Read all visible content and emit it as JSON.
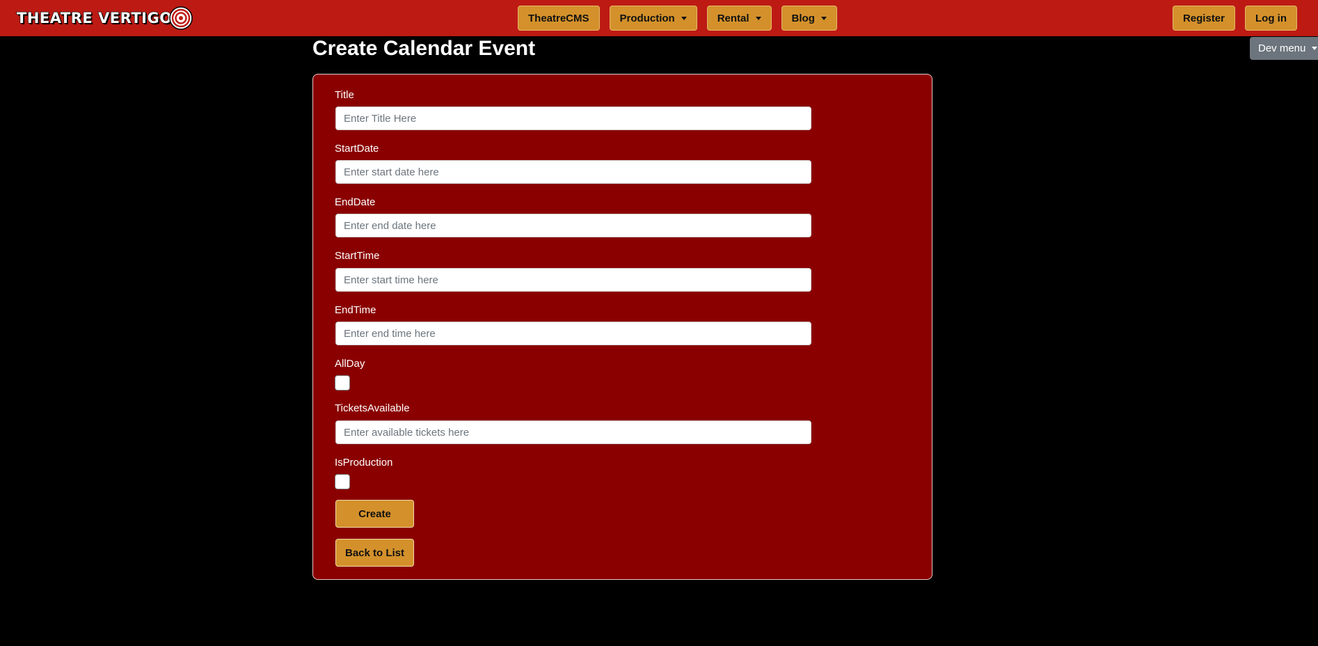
{
  "brand": {
    "name": "THEATRE VERTIGO",
    "logo_icon": "spiral-logo-icon"
  },
  "nav": {
    "center": [
      {
        "label": "TheatreCMS",
        "dropdown": false
      },
      {
        "label": "Production",
        "dropdown": true
      },
      {
        "label": "Rental",
        "dropdown": true
      },
      {
        "label": "Blog",
        "dropdown": true
      }
    ],
    "right": [
      {
        "label": "Register"
      },
      {
        "label": "Log in"
      }
    ]
  },
  "dev_menu": {
    "label": "Dev menu"
  },
  "page": {
    "title": "Create Calendar Event"
  },
  "form": {
    "fields": [
      {
        "label": "Title",
        "placeholder": "Enter Title Here",
        "value": ""
      },
      {
        "label": "StartDate",
        "placeholder": "Enter start date here",
        "value": ""
      },
      {
        "label": "EndDate",
        "placeholder": "Enter end date here",
        "value": ""
      },
      {
        "label": "StartTime",
        "placeholder": "Enter start time here",
        "value": ""
      },
      {
        "label": "EndTime",
        "placeholder": "Enter end time here",
        "value": ""
      },
      {
        "label": "AllDay",
        "checked": false
      },
      {
        "label": "TicketsAvailable",
        "placeholder": "Enter available tickets here",
        "value": ""
      },
      {
        "label": "IsProduction",
        "checked": false
      }
    ],
    "create_label": "Create",
    "back_label": "Back to List"
  },
  "colors": {
    "navbar": "#bd1a14",
    "button": "#d4912b",
    "card": "#8a0000",
    "page_background": "#000000",
    "dev_menu": "#6c757d"
  }
}
